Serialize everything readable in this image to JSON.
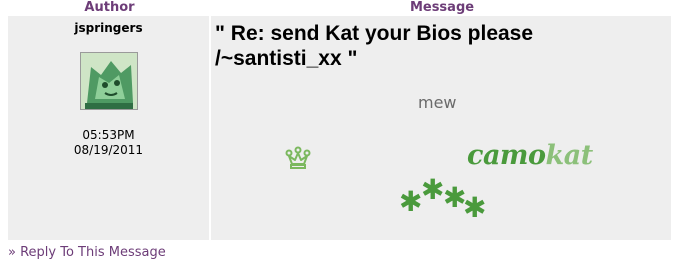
{
  "table": {
    "author_header": "Author",
    "message_header": "Message"
  },
  "post": {
    "author": "jspringers",
    "time": "05:53PM",
    "date": "08/19/2011",
    "title": "\" Re: send Kat your Bios please /~santisti_xx \"",
    "signature": {
      "mew": "mew",
      "logo_part1": "camo",
      "logo_part2": "kat",
      "stars": [
        "✱",
        "✱",
        "✱",
        "✱"
      ]
    }
  },
  "footer": {
    "reply_link": "» Reply To This Message"
  },
  "colors": {
    "header_text": "#6d3d78",
    "cell_background": "#eeeeee",
    "logo_green_dark": "#4a9a3c",
    "logo_green_light": "#8cc07a"
  },
  "icons": {
    "crown": "crown-icon",
    "avatar": "cat-avatar"
  }
}
